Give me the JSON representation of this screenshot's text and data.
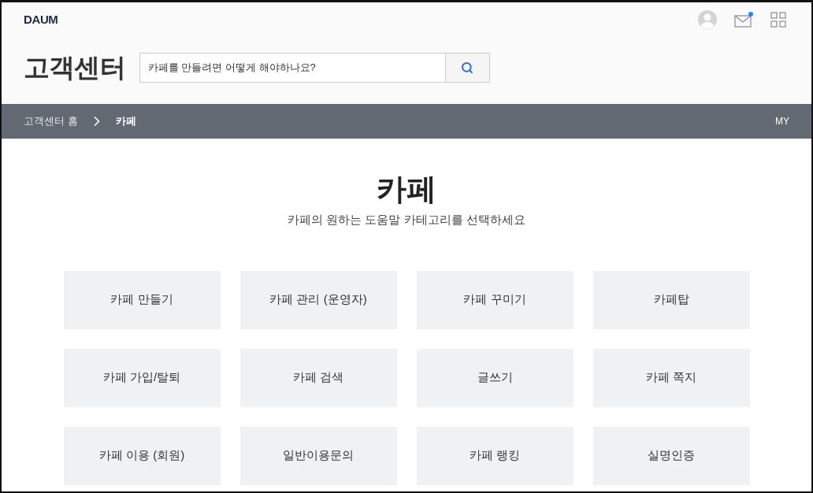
{
  "header": {
    "logo": "DAUM",
    "title": "고객센터",
    "search": {
      "placeholder": "카페를 만들려면 어떻게 해야하나요?"
    },
    "mail": {
      "unread": true
    }
  },
  "breadcrumb": {
    "items": [
      "고객센터 홈",
      "카페"
    ],
    "my": "MY"
  },
  "page": {
    "title": "카페",
    "subtitle": "카페의 원하는 도움말 카테고리를 선택하세요"
  },
  "categories": [
    "카페 만들기",
    "카페 관리 (운영자)",
    "카페 꾸미기",
    "카페탑",
    "카페 가입/탈퇴",
    "카페 검색",
    "글쓰기",
    "카페 쪽지",
    "카페 이용 (회원)",
    "일반이용문의",
    "카페 랭킹",
    "실명인증"
  ]
}
